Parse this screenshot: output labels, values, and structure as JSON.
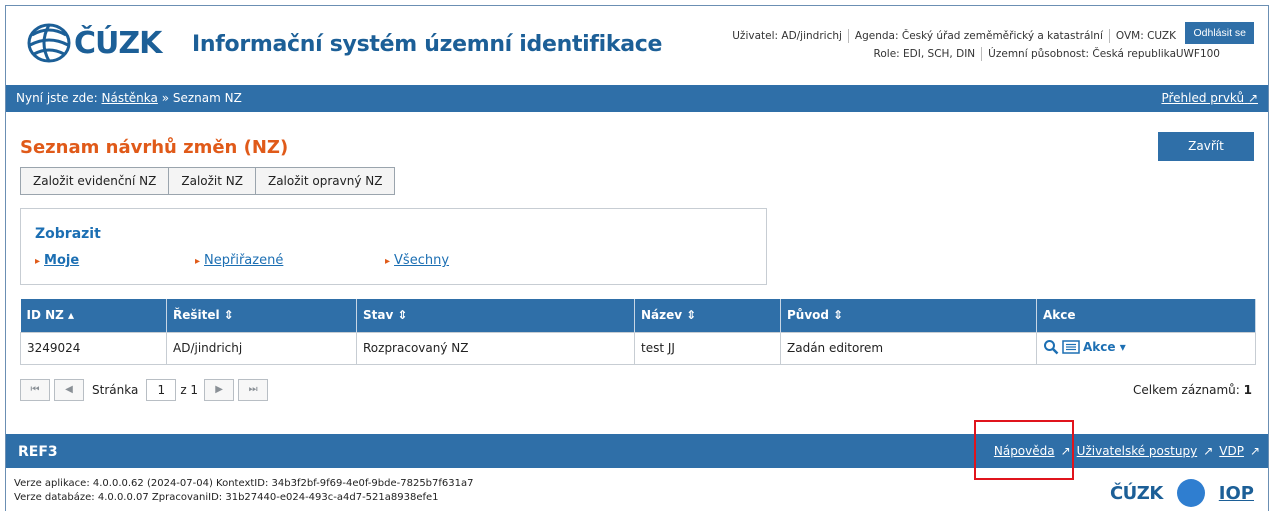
{
  "header": {
    "logo_text": "ČÚZK",
    "app_title": "Informační systém územní identifikace",
    "user_label": "Uživatel: AD/jindrichj",
    "agenda_label": "Agenda: Český úřad zeměměřický a katastrální",
    "ovm_label": "OVM: CUZK",
    "role_label": "Role: EDI, SCH, DIN",
    "territory_label": "Územní působnost: Česká republika",
    "ovm_code": "UWF100",
    "logout_label": "Odhlásit se"
  },
  "breadcrumb": {
    "prefix": "Nyní jste zde:",
    "home": "Nástěnka",
    "current": "» Seznam NZ",
    "overview_link": "Přehled prvků"
  },
  "page": {
    "title": "Seznam návrhů změn (NZ)",
    "close_label": "Zavřít",
    "buttons": [
      "Založit evidenční NZ",
      "Založit NZ",
      "Založit opravný NZ"
    ]
  },
  "filter": {
    "title": "Zobrazit",
    "options": [
      "Moje",
      "Nepřiřazené",
      "Všechny"
    ]
  },
  "table": {
    "headers": [
      "ID NZ ▴",
      "Řešitel ⇕",
      "Stav ⇕",
      "Název ⇕",
      "Původ ⇕",
      "Akce"
    ],
    "rows": [
      [
        "3249024",
        "AD/jindrichj",
        "Rozpracovaný NZ",
        "test JJ",
        "Zadán editorem"
      ]
    ],
    "action_label": "Akce ▾"
  },
  "pager": {
    "page_label": "Stránka",
    "page_value": "1",
    "of_label": "z 1",
    "total_label": "Celkem záznamů:",
    "total_value": "1"
  },
  "footer": {
    "section": "REF3",
    "links": [
      "Nápověda",
      "Uživatelské postupy",
      "VDP"
    ],
    "version_app": "Verze aplikace: 4.0.0.0.62 (2024-07-04) KontextID: 34b3f2bf-9f69-4e0f-9bde-7825b7f631a7",
    "version_db": "Verze databáze: 4.0.0.0.07 ZpracovaniID: 31b27440-e024-493c-a4d7-521a8938efe1",
    "logo_cuzk": "ČÚZK",
    "logo_iop": "IOP"
  },
  "colors": {
    "brand_blue": "#2f6fa8",
    "title_orange": "#e05a19",
    "highlight_red": "#e0141c"
  }
}
